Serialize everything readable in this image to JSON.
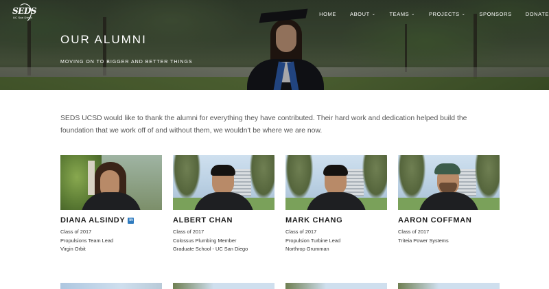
{
  "site": {
    "logo_text": "SEDS",
    "logo_subtext": "UC San Diego"
  },
  "nav": {
    "items": [
      {
        "label": "HOME",
        "has_dropdown": false
      },
      {
        "label": "ABOUT",
        "has_dropdown": true
      },
      {
        "label": "TEAMS",
        "has_dropdown": true
      },
      {
        "label": "PROJECTS",
        "has_dropdown": true
      },
      {
        "label": "SPONSORS",
        "has_dropdown": false
      },
      {
        "label": "DONATE",
        "has_dropdown": false
      }
    ]
  },
  "hero": {
    "title": "OUR ALUMNI",
    "subtitle": "MOVING ON TO BIGGER AND BETTER THINGS"
  },
  "intro": {
    "text": "SEDS UCSD would like to thank the alumni for everything they have contributed. Their hard work and dedication helped build the foundation that we work off of and without them, we wouldn't be where we are now."
  },
  "alumni": [
    {
      "name": "DIANA ALSINDY",
      "class": "Class of 2017",
      "role": "Propulsions Team Lead",
      "current": "Virgin Orbit",
      "linkedin": true
    },
    {
      "name": "ALBERT CHAN",
      "class": "Class of 2017",
      "role": "Colossus Plumbing Member",
      "current": "Graduate School - UC San Diego",
      "linkedin": false
    },
    {
      "name": "MARK CHANG",
      "class": "Class of 2017",
      "role": "Propulsion Turbine Lead",
      "current": "Northrop Grumman",
      "linkedin": false
    },
    {
      "name": "AARON COFFMAN",
      "class": "Class of 2017",
      "role": "Triteia Power Systems",
      "current": "",
      "linkedin": false
    }
  ],
  "icons": {
    "linkedin": "in",
    "chevron": "⌄"
  },
  "colors": {
    "linkedin_blue": "#2f7bbf",
    "heading_text": "#1d1d1d",
    "body_text": "#555555"
  }
}
